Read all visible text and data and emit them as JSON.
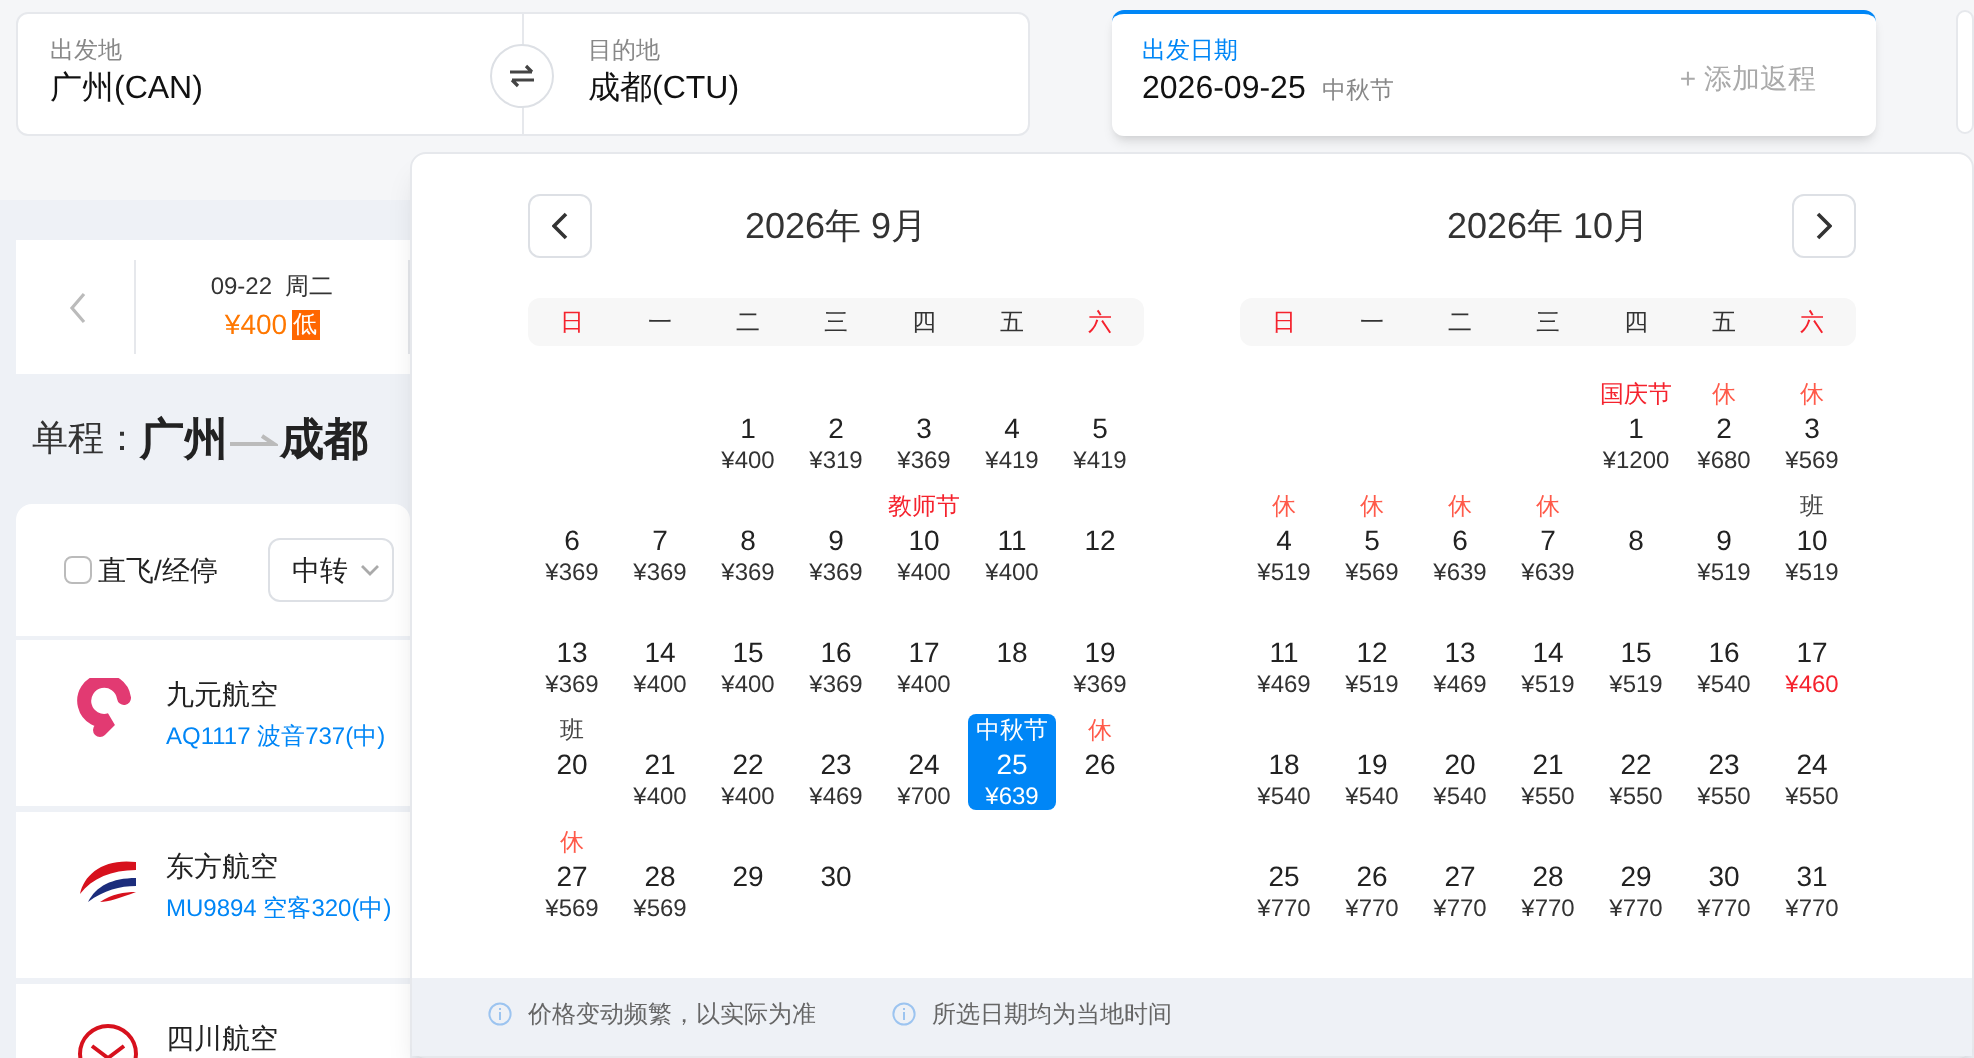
{
  "search": {
    "from": {
      "label": "出发地",
      "value": "广州(CAN)"
    },
    "to": {
      "label": "目的地",
      "value": "成都(CTU)"
    },
    "date": {
      "label": "出发日期",
      "value": "2026-09-25",
      "note": "中秋节",
      "return_button": "+ 添加返程"
    }
  },
  "date_strip": [
    {
      "date": "09-22",
      "weekday": "周二",
      "price": "¥400",
      "badge": "低"
    }
  ],
  "route": {
    "prefix": "单程：",
    "from": "广州",
    "to": "成都"
  },
  "filters": {
    "direct": {
      "label": "直飞/经停",
      "checked": false
    },
    "transfer": {
      "label": "中转"
    }
  },
  "flights": [
    {
      "kind": "nine",
      "airline": "九元航空",
      "flight": "AQ1117 波音737(中)"
    },
    {
      "kind": "swoosh",
      "airline": "东方航空",
      "flight": "MU9894 空客320(中)"
    },
    {
      "kind": "bird",
      "airline": "四川航空"
    }
  ],
  "calendar": {
    "months": [
      {
        "title": "2026年 9月",
        "weekdays": [
          {
            "label": "日",
            "weekend": true
          },
          {
            "label": "一",
            "weekend": false
          },
          {
            "label": "二",
            "weekend": false
          },
          {
            "label": "三",
            "weekend": false
          },
          {
            "label": "四",
            "weekend": false
          },
          {
            "label": "五",
            "weekend": false
          },
          {
            "label": "六",
            "weekend": true
          }
        ],
        "days": [
          {
            "kind": "empty"
          },
          {
            "kind": "empty"
          },
          {
            "kind": "day",
            "day": "1",
            "price": "¥400",
            "selected": false,
            "lowest": false
          },
          {
            "kind": "day",
            "day": "2",
            "price": "¥319",
            "selected": false,
            "lowest": false
          },
          {
            "kind": "day",
            "day": "3",
            "price": "¥369",
            "selected": false,
            "lowest": false
          },
          {
            "kind": "day",
            "day": "4",
            "price": "¥419",
            "selected": false,
            "lowest": false
          },
          {
            "kind": "day",
            "day": "5",
            "price": "¥419",
            "selected": false,
            "lowest": false
          },
          {
            "kind": "day",
            "day": "6",
            "price": "¥369",
            "selected": false,
            "lowest": false
          },
          {
            "kind": "day",
            "day": "7",
            "price": "¥369",
            "selected": false,
            "lowest": false
          },
          {
            "kind": "day",
            "day": "8",
            "price": "¥369",
            "selected": false,
            "lowest": false
          },
          {
            "kind": "day",
            "day": "9",
            "price": "¥369",
            "selected": false,
            "lowest": false
          },
          {
            "kind": "day",
            "day": "10",
            "price": "¥400",
            "tag": {
              "kind": "holiday",
              "text": "教师节"
            },
            "selected": false,
            "lowest": false
          },
          {
            "kind": "day",
            "day": "11",
            "price": "¥400",
            "selected": false,
            "lowest": false
          },
          {
            "kind": "day",
            "day": "12",
            "selected": false
          },
          {
            "kind": "day",
            "day": "13",
            "price": "¥369",
            "selected": false,
            "lowest": false
          },
          {
            "kind": "day",
            "day": "14",
            "price": "¥400",
            "selected": false,
            "lowest": false
          },
          {
            "kind": "day",
            "day": "15",
            "price": "¥400",
            "selected": false,
            "lowest": false
          },
          {
            "kind": "day",
            "day": "16",
            "price": "¥369",
            "selected": false,
            "lowest": false
          },
          {
            "kind": "day",
            "day": "17",
            "price": "¥400",
            "selected": false,
            "lowest": false
          },
          {
            "kind": "day",
            "day": "18",
            "selected": false
          },
          {
            "kind": "day",
            "day": "19",
            "price": "¥369",
            "selected": false,
            "lowest": false
          },
          {
            "kind": "day",
            "day": "20",
            "tag": {
              "kind": "work",
              "text": "班"
            },
            "selected": false
          },
          {
            "kind": "day",
            "day": "21",
            "price": "¥400",
            "selected": false,
            "lowest": false
          },
          {
            "kind": "day",
            "day": "22",
            "price": "¥400",
            "selected": false,
            "lowest": false
          },
          {
            "kind": "day",
            "day": "23",
            "price": "¥469",
            "selected": false,
            "lowest": false
          },
          {
            "kind": "day",
            "day": "24",
            "price": "¥700",
            "selected": false,
            "lowest": false
          },
          {
            "kind": "day",
            "day": "25",
            "price": "¥639",
            "tag": {
              "kind": "holiday",
              "text": "中秋节"
            },
            "selected": true
          },
          {
            "kind": "day",
            "day": "26",
            "tag": {
              "kind": "rest",
              "text": "休"
            },
            "selected": false
          },
          {
            "kind": "day",
            "day": "27",
            "price": "¥569",
            "tag": {
              "kind": "rest",
              "text": "休"
            },
            "selected": false,
            "lowest": false
          },
          {
            "kind": "day",
            "day": "28",
            "price": "¥569",
            "selected": false,
            "lowest": false
          },
          {
            "kind": "day",
            "day": "29",
            "selected": false
          },
          {
            "kind": "day",
            "day": "30",
            "selected": false
          }
        ]
      },
      {
        "title": "2026年 10月",
        "weekdays": [
          {
            "label": "日",
            "weekend": true
          },
          {
            "label": "一",
            "weekend": false
          },
          {
            "label": "二",
            "weekend": false
          },
          {
            "label": "三",
            "weekend": false
          },
          {
            "label": "四",
            "weekend": false
          },
          {
            "label": "五",
            "weekend": false
          },
          {
            "label": "六",
            "weekend": true
          }
        ],
        "days": [
          {
            "kind": "empty"
          },
          {
            "kind": "empty"
          },
          {
            "kind": "empty"
          },
          {
            "kind": "empty"
          },
          {
            "kind": "day",
            "day": "1",
            "price": "¥1200",
            "tag": {
              "kind": "holiday",
              "text": "国庆节"
            },
            "selected": false,
            "lowest": false
          },
          {
            "kind": "day",
            "day": "2",
            "price": "¥680",
            "tag": {
              "kind": "rest",
              "text": "休"
            },
            "selected": false,
            "lowest": false
          },
          {
            "kind": "day",
            "day": "3",
            "price": "¥569",
            "tag": {
              "kind": "rest",
              "text": "休"
            },
            "selected": false,
            "lowest": false
          },
          {
            "kind": "day",
            "day": "4",
            "price": "¥519",
            "tag": {
              "kind": "rest",
              "text": "休"
            },
            "selected": false,
            "lowest": false
          },
          {
            "kind": "day",
            "day": "5",
            "price": "¥569",
            "tag": {
              "kind": "rest",
              "text": "休"
            },
            "selected": false,
            "lowest": false
          },
          {
            "kind": "day",
            "day": "6",
            "price": "¥639",
            "tag": {
              "kind": "rest",
              "text": "休"
            },
            "selected": false,
            "lowest": false
          },
          {
            "kind": "day",
            "day": "7",
            "price": "¥639",
            "tag": {
              "kind": "rest",
              "text": "休"
            },
            "selected": false,
            "lowest": false
          },
          {
            "kind": "day",
            "day": "8",
            "selected": false
          },
          {
            "kind": "day",
            "day": "9",
            "price": "¥519",
            "selected": false,
            "lowest": false
          },
          {
            "kind": "day",
            "day": "10",
            "price": "¥519",
            "tag": {
              "kind": "work",
              "text": "班"
            },
            "selected": false,
            "lowest": false
          },
          {
            "kind": "day",
            "day": "11",
            "price": "¥469",
            "selected": false,
            "lowest": false
          },
          {
            "kind": "day",
            "day": "12",
            "price": "¥519",
            "selected": false,
            "lowest": false
          },
          {
            "kind": "day",
            "day": "13",
            "price": "¥469",
            "selected": false,
            "lowest": false
          },
          {
            "kind": "day",
            "day": "14",
            "price": "¥519",
            "selected": false,
            "lowest": false
          },
          {
            "kind": "day",
            "day": "15",
            "price": "¥519",
            "selected": false,
            "lowest": false
          },
          {
            "kind": "day",
            "day": "16",
            "price": "¥540",
            "selected": false,
            "lowest": false
          },
          {
            "kind": "day",
            "day": "17",
            "price": "¥460",
            "selected": false,
            "lowest": true
          },
          {
            "kind": "day",
            "day": "18",
            "price": "¥540",
            "selected": false,
            "lowest": false
          },
          {
            "kind": "day",
            "day": "19",
            "price": "¥540",
            "selected": false,
            "lowest": false
          },
          {
            "kind": "day",
            "day": "20",
            "price": "¥540",
            "selected": false,
            "lowest": false
          },
          {
            "kind": "day",
            "day": "21",
            "price": "¥550",
            "selected": false,
            "lowest": false
          },
          {
            "kind": "day",
            "day": "22",
            "price": "¥550",
            "selected": false,
            "lowest": false
          },
          {
            "kind": "day",
            "day": "23",
            "price": "¥550",
            "selected": false,
            "lowest": false
          },
          {
            "kind": "day",
            "day": "24",
            "price": "¥550",
            "selected": false,
            "lowest": false
          },
          {
            "kind": "day",
            "day": "25",
            "price": "¥770",
            "selected": false,
            "lowest": false
          },
          {
            "kind": "day",
            "day": "26",
            "price": "¥770",
            "selected": false,
            "lowest": false
          },
          {
            "kind": "day",
            "day": "27",
            "price": "¥770",
            "selected": false,
            "lowest": false
          },
          {
            "kind": "day",
            "day": "28",
            "price": "¥770",
            "selected": false,
            "lowest": false
          },
          {
            "kind": "day",
            "day": "29",
            "price": "¥770",
            "selected": false,
            "lowest": false
          },
          {
            "kind": "day",
            "day": "30",
            "price": "¥770",
            "selected": false,
            "lowest": false
          },
          {
            "kind": "day",
            "day": "31",
            "price": "¥770",
            "selected": false,
            "lowest": false
          }
        ]
      }
    ],
    "notes": [
      "价格变动频繁，以实际为准",
      "所选日期均为当地时间"
    ]
  }
}
